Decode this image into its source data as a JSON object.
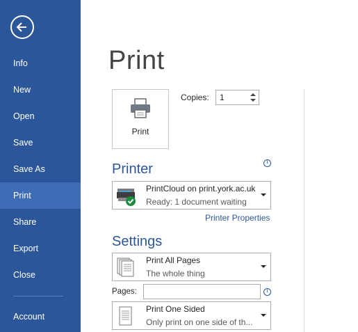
{
  "sidebar": {
    "items": [
      {
        "label": "Info"
      },
      {
        "label": "New"
      },
      {
        "label": "Open"
      },
      {
        "label": "Save"
      },
      {
        "label": "Save As"
      },
      {
        "label": "Print",
        "active": true
      },
      {
        "label": "Share"
      },
      {
        "label": "Export"
      },
      {
        "label": "Close"
      },
      {
        "label": "Account"
      }
    ]
  },
  "main": {
    "title": "Print",
    "print_button_label": "Print",
    "copies": {
      "label": "Copies:",
      "value": "1"
    },
    "printer": {
      "heading": "Printer",
      "name": "PrintCloud on print.york.ac.uk",
      "status": "Ready: 1 document waiting",
      "properties_link": "Printer Properties"
    },
    "settings": {
      "heading": "Settings",
      "pages_dropdown": {
        "title": "Print All Pages",
        "subtitle": "The whole thing"
      },
      "pages_field": {
        "label": "Pages:",
        "value": ""
      },
      "sides_dropdown": {
        "title": "Print One Sided",
        "subtitle": "Only print on one side of th..."
      }
    }
  },
  "colors": {
    "sidebar_bg": "#2b579a",
    "sidebar_active": "#3e6db5",
    "accent": "#2b579a"
  }
}
